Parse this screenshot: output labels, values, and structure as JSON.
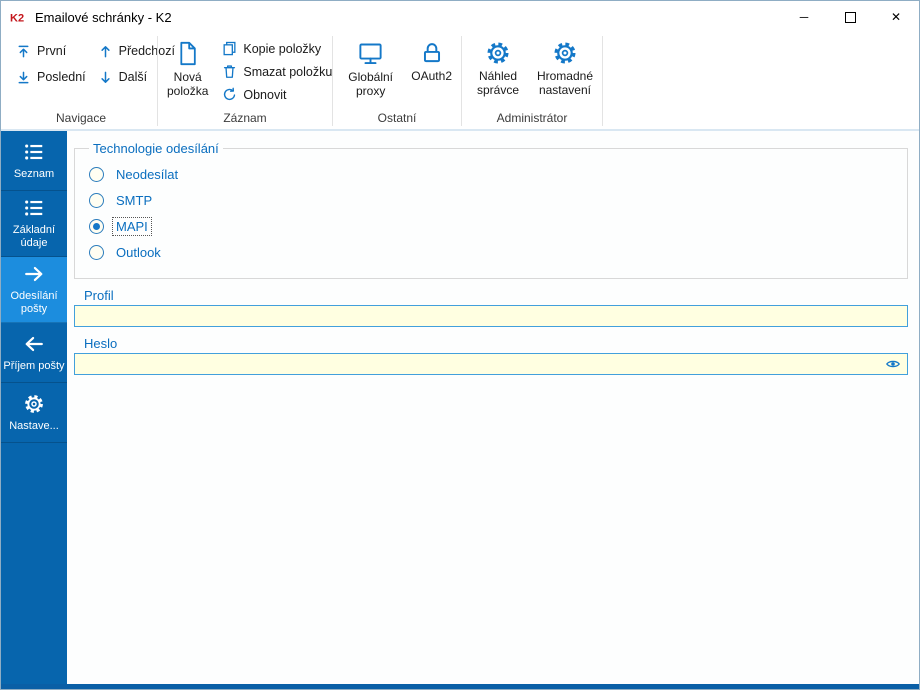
{
  "window": {
    "title": "Emailové schránky - K2",
    "minimize_glyph": "─",
    "close_glyph": "✕"
  },
  "ribbon": {
    "navigation": {
      "label": "Navigace",
      "first": "První",
      "last": "Poslední",
      "previous": "Předchozí",
      "next": "Další"
    },
    "record": {
      "label": "Záznam",
      "new_item": "Nová položka",
      "copy_item": "Kopie položky",
      "delete_item": "Smazat položku",
      "refresh": "Obnovit"
    },
    "other": {
      "label": "Ostatní",
      "global_proxy": "Globální proxy",
      "oauth2": "OAuth2"
    },
    "administrator": {
      "label": "Administrátor",
      "admin_preview": "Náhled správce",
      "bulk_settings": "Hromadné nastavení"
    }
  },
  "sidebar": {
    "items": [
      {
        "label": "Seznam",
        "icon": "list-icon",
        "active": false
      },
      {
        "label": "Základní údaje",
        "icon": "list-icon",
        "active": false
      },
      {
        "label": "Odesílání pošty",
        "icon": "arrow-right-icon",
        "active": true
      },
      {
        "label": "Příjem pošty",
        "icon": "arrow-left-icon",
        "active": false
      },
      {
        "label": "Nastave...",
        "icon": "gear-icon",
        "active": false
      }
    ]
  },
  "main": {
    "group_title": "Technologie odesílání",
    "send_options": [
      {
        "label": "Neodesílat",
        "selected": false
      },
      {
        "label": "SMTP",
        "selected": false
      },
      {
        "label": "MAPI",
        "selected": true
      },
      {
        "label": "Outlook",
        "selected": false
      }
    ],
    "profile": {
      "label": "Profil",
      "value": ""
    },
    "password": {
      "label": "Heslo",
      "value": ""
    }
  },
  "colors": {
    "accent": "#1478c8",
    "sidebar_bg": "#0765ad",
    "sidebar_active": "#1c8dde",
    "label_blue": "#0a6ebf",
    "input_bg": "#ffffe1",
    "input_border": "#42a0dc",
    "bottom_bar": "#0a5fa6"
  }
}
